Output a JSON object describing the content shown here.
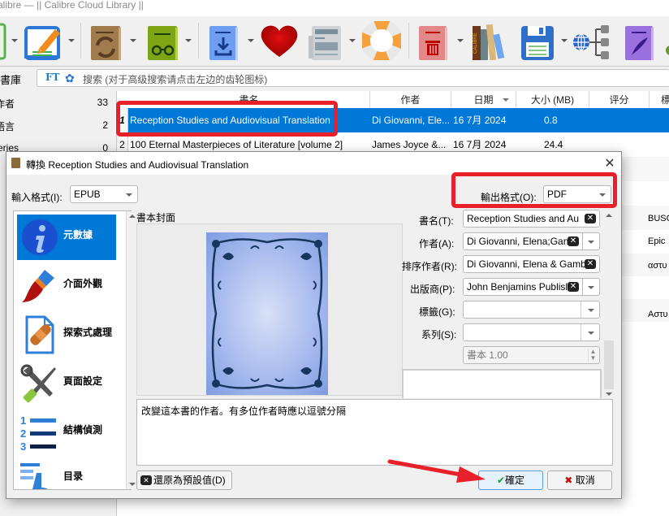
{
  "window": {
    "title": "alibre — || Calibre Cloud Library ||"
  },
  "toolbar": {
    "icons": [
      "add-book-icon",
      "edit-metadata-icon",
      "convert-books-icon",
      "view-book-icon",
      "download-icon",
      "heart-icon",
      "news-icon",
      "help-icon",
      "remove-books-icon",
      "library-icon",
      "save-to-disk-icon",
      "connect-share-icon",
      "edit-book-icon"
    ]
  },
  "search": {
    "library_label": "書庫",
    "ft_label": "FT",
    "placeholder": "搜索 (对于高级搜索请点击左边的齿轮图标)"
  },
  "sidebar": {
    "items": [
      {
        "label": "作者",
        "count": "33"
      },
      {
        "label": "語言",
        "count": "2"
      },
      {
        "label": "eries",
        "count": "0"
      }
    ]
  },
  "table": {
    "headers": [
      "書名",
      "作者",
      "日期",
      "大小 (MB)",
      "评分",
      "標"
    ],
    "rows": [
      {
        "num": "1",
        "title": "Reception Studies and Audiovisual Translation",
        "author": "Di Giovanni, Ele...",
        "date": "16 7月 2024",
        "size": "0.8",
        "selected": true
      },
      {
        "num": "2",
        "title": "100 Eternal Masterpieces of Literature [volume 2]",
        "author": "James Joyce &...",
        "date": "16 7月 2024",
        "size": "24.4",
        "selected": false
      }
    ],
    "right_column_values": [
      "BUSC",
      "Epic",
      "αστυ",
      "",
      "Αστυ"
    ]
  },
  "dialog": {
    "title": "轉換 Reception Studies and Audiovisual Translation",
    "input_format_label": "輸入格式(I):",
    "input_format_value": "EPUB",
    "output_format_label": "輸出格式(O):",
    "output_format_value": "PDF",
    "nav": [
      {
        "label": "元數據",
        "icon": "info-icon",
        "selected": true
      },
      {
        "label": "介面外觀",
        "icon": "paintbrush-icon",
        "selected": false
      },
      {
        "label": "探索式處理",
        "icon": "heuristics-icon",
        "selected": false
      },
      {
        "label": "頁面設定",
        "icon": "tools-icon",
        "selected": false
      },
      {
        "label": "結構偵測",
        "icon": "numbered-list-icon",
        "selected": false
      },
      {
        "label": "目录",
        "icon": "toc-icon",
        "selected": false
      }
    ],
    "cover_label": "書本封面",
    "fields": {
      "title_label": "書名(T):",
      "title_value": "Reception Studies and Au",
      "author_label": "作者(A):",
      "author_value": "Di Giovanni, Elena;Gan",
      "sort_label": "排序作者(R):",
      "sort_value": "Di Giovanni, Elena & Gamb",
      "publisher_label": "出版商(P):",
      "publisher_value": "John Benjamins Publisl",
      "tags_label": "標籤(G):",
      "tags_value": "",
      "series_label": "系列(S):",
      "series_value": "",
      "series_index": "書本 1.00"
    },
    "description": "改變這本書的作者。有多位作者時應以逗號分隔",
    "reset_label": "還原為預設值(D)",
    "ok_label": "確定",
    "cancel_label": "取消"
  }
}
